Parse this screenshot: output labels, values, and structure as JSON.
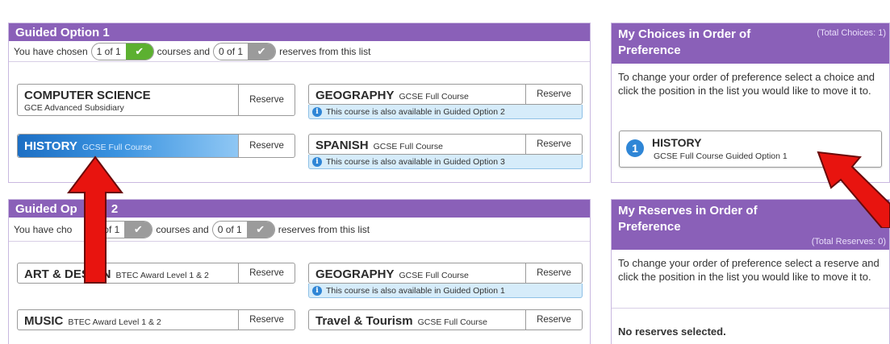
{
  "guided1": {
    "title": "Guided Option 1",
    "summary": {
      "prefix": "You have chosen",
      "chosen": "1 of 1",
      "middle": "courses and",
      "reserves": "0 of 1",
      "suffix": "reserves from this list"
    },
    "courses": [
      {
        "name": "COMPUTER SCIENCE",
        "type": "",
        "sub": "GCE Advanced Subsidiary",
        "reserve": "Reserve"
      },
      {
        "name": "GEOGRAPHY",
        "type": "GCSE Full Course",
        "reserve": "Reserve",
        "info": "This course is also available in Guided Option 2"
      },
      {
        "name": "HISTORY",
        "type": "GCSE Full Course",
        "reserve": "Reserve"
      },
      {
        "name": "SPANISH",
        "type": "GCSE Full Course",
        "reserve": "Reserve",
        "info": "This course is also available in Guided Option 3"
      }
    ]
  },
  "guided2": {
    "title_left": "Guided Op",
    "title_right": "2",
    "summary": {
      "prefix": "You have cho",
      "chosen": "0 of 1",
      "middle": "courses and",
      "reserves": "0 of 1",
      "suffix": "reserves from this list"
    },
    "courses": [
      {
        "name": "ART & DESIGN",
        "type": "BTEC Award Level 1 & 2",
        "reserve": "Reserve"
      },
      {
        "name": "GEOGRAPHY",
        "type": "GCSE Full Course",
        "reserve": "Reserve",
        "info": "This course is also available in Guided Option 1"
      },
      {
        "name": "MUSIC",
        "type": "BTEC Award Level 1 & 2",
        "reserve": "Reserve"
      },
      {
        "name": "Travel & Tourism",
        "type": "GCSE Full Course",
        "reserve": "Reserve"
      }
    ]
  },
  "choices": {
    "title": "My Choices in Order of Preference",
    "total": "(Total Choices: 1)",
    "instructions": "To change your order of preference select a choice and click the position in the list you would like to move it to.",
    "items": [
      {
        "number": "1",
        "name": "HISTORY",
        "detail": "GCSE Full Course Guided Option 1"
      }
    ]
  },
  "reserves": {
    "title": "My Reserves in Order of Preference",
    "total": "(Total Reserves: 0)",
    "instructions": "To change your order of preference select a reserve and click the position in the list you would like to move it to.",
    "empty": "No reserves selected."
  },
  "colors": {
    "header_purple": "#8a60b8",
    "selected_blue": "#1d6fc4",
    "check_green": "#5cb030",
    "check_grey": "#9b9b9b",
    "info_blue": "#d6ecfa",
    "arrow_red": "#e8140f"
  }
}
